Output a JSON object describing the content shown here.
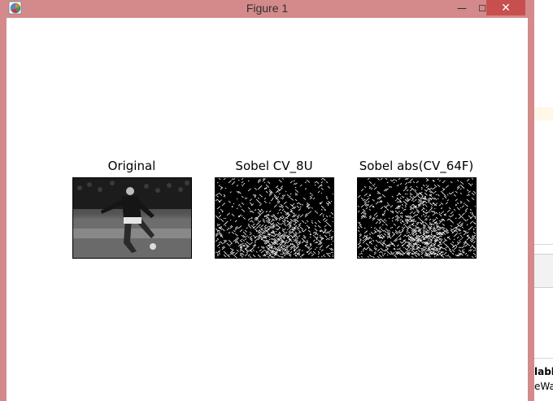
{
  "window": {
    "title": "Figure 1",
    "icon": "matplotlib-figure-icon",
    "controls": {
      "minimize_glyph": "—",
      "maximize_glyph": "☐",
      "close_glyph": "✕"
    },
    "titlebar_color": "#d48a8a",
    "close_color": "#c7504f"
  },
  "figure": {
    "subplots": [
      {
        "title": "Original",
        "image": "soccer-player-grayscale"
      },
      {
        "title": "Sobel CV_8U",
        "image": "sobel-edges-8u"
      },
      {
        "title": "Sobel abs(CV_64F)",
        "image": "sobel-edges-abs-64f"
      }
    ]
  },
  "background_window": {
    "text_line_1": "lable",
    "text_line_2": "eWa"
  }
}
